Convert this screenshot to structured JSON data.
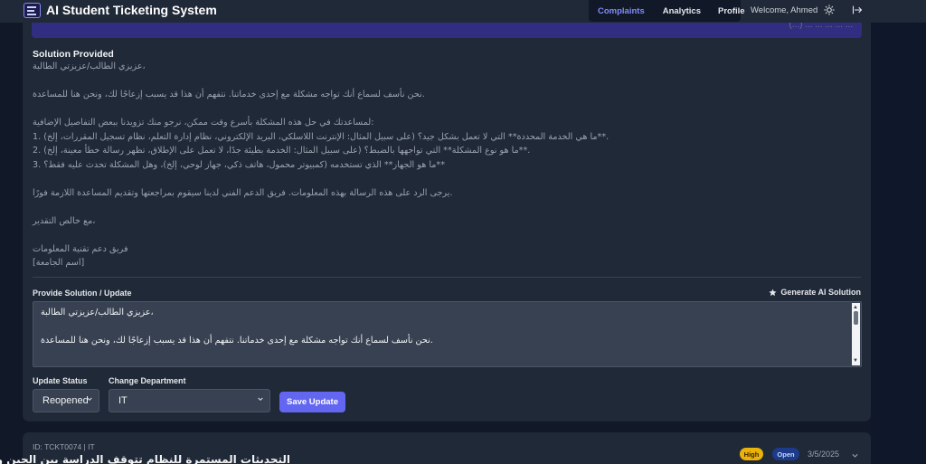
{
  "app": {
    "title": "AI Student Ticketing System",
    "welcome": "Welcome, Ahmed"
  },
  "nav": {
    "items": [
      "Complaints",
      "Analytics",
      "Profile"
    ],
    "active": "Complaints"
  },
  "icons": {
    "logo": "list-icon",
    "theme": "sun-icon",
    "logout": "logout-icon",
    "generate": "star-icon",
    "expand": "chevron-down-icon"
  },
  "colors": {
    "accent": "#6366f1",
    "background": "#111827",
    "card": "#1f2937",
    "high": "#eab308",
    "open": "#1e3a8a"
  },
  "ticket_detail": {
    "top_strip_text": "(...) ... ... ... ... ...",
    "solution_title": "Solution Provided",
    "solution_lines": [
      "عزيزي الطالب/عزيزتي الطالبة،",
      "",
      "نحن نأسف لسماع أنك تواجه مشكلة مع إحدى خدماتنا. نتفهم أن هذا قد يسبب إزعاجًا لك، ونحن هنا للمساعدة.",
      "",
      "لمساعدتك في حل هذه المشكلة بأسرع وقت ممكن، نرجو منك تزويدنا ببعض التفاصيل الإضافية:",
      "1. ما هي الخدمة المحددة** التي لا تعمل بشكل جيد؟ (على سبيل المثال: الإنترنت اللاسلكي، البريد الإلكتروني، نظام إدارة التعلم، نظام تسجيل المقررات، إلخ)**.",
      "2. ما هو نوع المشكلة** التي تواجهها بالضبط؟ (على سبيل المثال: الخدمة بطيئة جدًا، لا تعمل على الإطلاق، تظهر رسالة خطأ معينة، إلخ)**.",
      "3. ما هو الجهاز** الذي تستخدمه (كمبيوتر محمول، هاتف ذكي، جهاز لوحي، إلخ)، وهل المشكلة تحدث عليه فقط؟**",
      "",
      "يرجى الرد على هذه الرسالة بهذه المعلومات. فريق الدعم الفني لدينا سيقوم بمراجعتها وتقديم المساعدة اللازمة فورًا.",
      "",
      "مع خالص التقدير،",
      "",
      "فريق دعم تقنية المعلومات",
      "[اسم الجامعة]"
    ],
    "provide_label": "Provide Solution / Update",
    "generate_label": "Generate AI Solution",
    "textarea_lines": [
      "عزيزي الطالب/عزيزتي الطالبة،",
      "",
      "نحن نأسف لسماع أنك تواجه مشكلة مع إحدى خدماتنا. نتفهم أن هذا قد يسبب إزعاجًا لك، ونحن هنا للمساعدة."
    ],
    "update_status_label": "Update Status",
    "status_value": "Reopened",
    "change_department_label": "Change Department",
    "department_value": "IT",
    "save_label": "Save Update"
  },
  "next_ticket": {
    "id_line": "ID: TCKT0074 | IT",
    "title": "التحديثات المستمرة للنظام تتوقف الدراسة بين الحين والآخر.",
    "priority": "High",
    "status": "Open",
    "date": "3/5/2025"
  }
}
